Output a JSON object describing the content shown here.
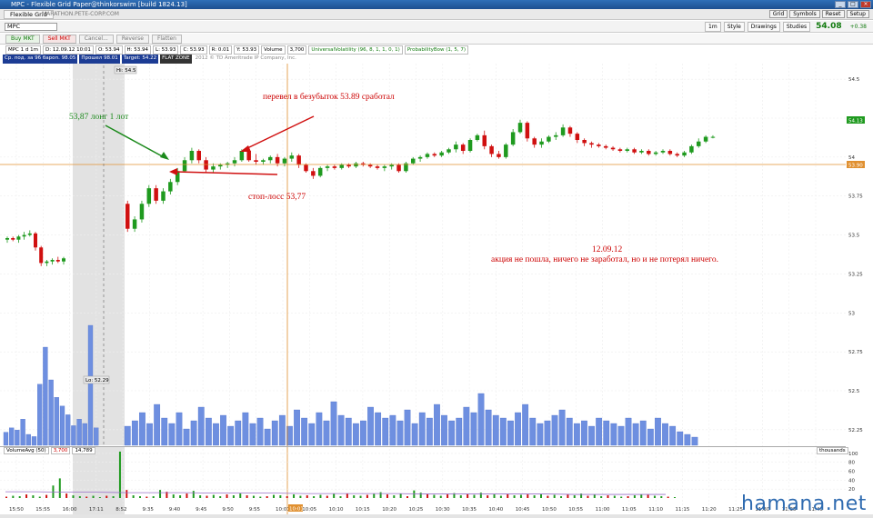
{
  "window": {
    "title": "MPC - Flexible Grid Paper@thinkorswim [build 1824.13]",
    "buttons": [
      "_",
      "□",
      "×"
    ]
  },
  "menubar": {
    "tab": "Flexible Grid",
    "site": "MARATHON.PETE-CORP.COM",
    "buttons": [
      "Grid",
      "Symbols",
      "Reset",
      "Setup"
    ]
  },
  "toolbar": {
    "symbol": "MPC",
    "aggregation": "1m",
    "controls": [
      "Style",
      "Drawings",
      "Studies"
    ],
    "last_price": "54.08",
    "change": "+0.38"
  },
  "order_bar": {
    "buy": "Buy MKT",
    "sell": "Sell MKT",
    "cancel": "Cancel...",
    "reverse": "Reverse",
    "flatten": "Flatten"
  },
  "info_bar": {
    "symbol": "MPC 1 d 1m",
    "date": "D: 12.09.12 10:01",
    "open": "O: 53.94",
    "high": "H: 53.94",
    "low": "L: 53.93",
    "close": "C: 53.93",
    "range": "R: 0.01",
    "y": "Y: 53.93",
    "volume_label": "Volume",
    "volume_val": "3,700",
    "study1": "UniversalVolatility (96, 8, 1, 1, 0, 1)",
    "study2": "ProbabilityBow (1, 5, 7)"
  },
  "position_bar": {
    "avg_price": "Ср. под. за 96 бароп. 98.05",
    "pnl": "Прошел 98.01",
    "target": "Target: 54.22",
    "flat": "FLAT ZONE",
    "copyright": "2012 © TD Ameritrade IP Company, Inc."
  },
  "volume_panel": {
    "label": "VolumeAvg (50)",
    "val1": "3,700",
    "val2": "14,789",
    "units": "thousands"
  },
  "annotations": {
    "long": "53,87 лонг 1 лот",
    "breakeven": "перевел в безубыток 53.89 сработал",
    "stop": "стоп-лосс 53,77",
    "date": "12.09.12",
    "summary": "акция не пошла, ничего не заработал, но и  не потерял ничего."
  },
  "markers": {
    "high": "Hi: 54.5",
    "low": "Lo: 52.29"
  },
  "watermark": "hamana.net",
  "colors": {
    "up": "#1f9a1f",
    "down": "#d01010",
    "volume_bar": "#6e8fe0",
    "arrow_green": "#1c8a1c",
    "arrow_red": "#d01010",
    "price_line": "#e09030"
  },
  "chart_data": {
    "type": "candlestick",
    "price_axis": [
      "54.5",
      "54.25",
      "54",
      "53.75",
      "53.5",
      "53.25",
      "53",
      "52.75",
      "52.5",
      "52.25"
    ],
    "ylim": [
      52.15,
      54.6
    ],
    "time_labels": [
      "15:50",
      "15:55",
      "16:00",
      "17:11",
      "8:52",
      "9:35",
      "9:40",
      "9:45",
      "9:50",
      "9:55",
      "10:01",
      "10:05",
      "10:10",
      "10:15",
      "10:20",
      "10:25",
      "10:30",
      "10:35",
      "10:40",
      "10:45",
      "10:50",
      "10:55",
      "11:00",
      "11:05",
      "11:10",
      "11:15",
      "11:20",
      "11:25",
      "11:30",
      "11:35",
      "11:40"
    ],
    "last_price_label": "54.13",
    "crosshair_price_label": "53.90",
    "crosshair_time_label": "10:01",
    "volume_axis": [
      "100",
      "80",
      "60",
      "40",
      "20"
    ],
    "volume_ylim": [
      0,
      110
    ],
    "candles_pre": [
      {
        "o": 53.47,
        "h": 53.49,
        "l": 53.45,
        "c": 53.48
      },
      {
        "o": 53.48,
        "h": 53.49,
        "l": 53.46,
        "c": 53.47
      },
      {
        "o": 53.47,
        "h": 53.5,
        "l": 53.45,
        "c": 53.49
      },
      {
        "o": 53.49,
        "h": 53.52,
        "l": 53.47,
        "c": 53.5
      },
      {
        "o": 53.5,
        "h": 53.53,
        "l": 53.49,
        "c": 53.51
      },
      {
        "o": 53.51,
        "h": 53.52,
        "l": 53.4,
        "c": 53.42
      },
      {
        "o": 53.42,
        "h": 53.43,
        "l": 53.3,
        "c": 53.32
      },
      {
        "o": 53.32,
        "h": 53.34,
        "l": 53.3,
        "c": 53.33
      },
      {
        "o": 53.33,
        "h": 53.35,
        "l": 53.31,
        "c": 53.34
      },
      {
        "o": 53.34,
        "h": 53.36,
        "l": 53.32,
        "c": 53.33
      },
      {
        "o": 53.33,
        "h": 53.36,
        "l": 53.31,
        "c": 53.35
      }
    ],
    "candles": [
      {
        "o": 53.7,
        "h": 53.72,
        "l": 53.52,
        "c": 53.54
      },
      {
        "o": 53.54,
        "h": 53.62,
        "l": 53.52,
        "c": 53.6
      },
      {
        "o": 53.6,
        "h": 53.72,
        "l": 53.58,
        "c": 53.7
      },
      {
        "o": 53.7,
        "h": 53.82,
        "l": 53.68,
        "c": 53.8
      },
      {
        "o": 53.8,
        "h": 53.82,
        "l": 53.7,
        "c": 53.72
      },
      {
        "o": 53.72,
        "h": 53.8,
        "l": 53.7,
        "c": 53.78
      },
      {
        "o": 53.78,
        "h": 53.86,
        "l": 53.76,
        "c": 53.84
      },
      {
        "o": 53.84,
        "h": 53.93,
        "l": 53.82,
        "c": 53.91
      },
      {
        "o": 53.91,
        "h": 54.0,
        "l": 53.9,
        "c": 53.98
      },
      {
        "o": 53.98,
        "h": 54.06,
        "l": 53.96,
        "c": 54.04
      },
      {
        "o": 54.04,
        "h": 54.05,
        "l": 53.96,
        "c": 53.98
      },
      {
        "o": 53.98,
        "h": 54.0,
        "l": 53.9,
        "c": 53.92
      },
      {
        "o": 53.92,
        "h": 53.96,
        "l": 53.9,
        "c": 53.94
      },
      {
        "o": 53.94,
        "h": 53.96,
        "l": 53.92,
        "c": 53.95
      },
      {
        "o": 53.95,
        "h": 53.97,
        "l": 53.93,
        "c": 53.96
      },
      {
        "o": 53.96,
        "h": 54.0,
        "l": 53.94,
        "c": 53.98
      },
      {
        "o": 53.98,
        "h": 54.05,
        "l": 53.97,
        "c": 54.04
      },
      {
        "o": 54.04,
        "h": 54.06,
        "l": 53.97,
        "c": 53.98
      },
      {
        "o": 53.98,
        "h": 54.02,
        "l": 53.95,
        "c": 53.97
      },
      {
        "o": 53.97,
        "h": 53.99,
        "l": 53.95,
        "c": 53.98
      },
      {
        "o": 53.98,
        "h": 54.01,
        "l": 53.96,
        "c": 54.0
      },
      {
        "o": 54.0,
        "h": 54.02,
        "l": 53.94,
        "c": 53.96
      },
      {
        "o": 53.96,
        "h": 54.0,
        "l": 53.94,
        "c": 53.99
      },
      {
        "o": 53.99,
        "h": 54.03,
        "l": 53.97,
        "c": 54.01
      },
      {
        "o": 54.01,
        "h": 54.02,
        "l": 53.93,
        "c": 53.95
      },
      {
        "o": 53.95,
        "h": 53.96,
        "l": 53.9,
        "c": 53.91
      },
      {
        "o": 53.91,
        "h": 53.93,
        "l": 53.86,
        "c": 53.88
      },
      {
        "o": 53.88,
        "h": 53.94,
        "l": 53.87,
        "c": 53.93
      },
      {
        "o": 53.93,
        "h": 53.95,
        "l": 53.91,
        "c": 53.94
      },
      {
        "o": 53.94,
        "h": 53.95,
        "l": 53.92,
        "c": 53.93
      },
      {
        "o": 53.93,
        "h": 53.96,
        "l": 53.92,
        "c": 53.95
      },
      {
        "o": 53.95,
        "h": 53.96,
        "l": 53.93,
        "c": 53.94
      },
      {
        "o": 53.94,
        "h": 53.97,
        "l": 53.93,
        "c": 53.96
      },
      {
        "o": 53.96,
        "h": 53.97,
        "l": 53.94,
        "c": 53.95
      },
      {
        "o": 53.95,
        "h": 53.96,
        "l": 53.93,
        "c": 53.94
      },
      {
        "o": 53.94,
        "h": 53.95,
        "l": 53.92,
        "c": 53.93
      },
      {
        "o": 53.93,
        "h": 53.95,
        "l": 53.91,
        "c": 53.94
      },
      {
        "o": 53.94,
        "h": 53.96,
        "l": 53.92,
        "c": 53.95
      },
      {
        "o": 53.95,
        "h": 53.96,
        "l": 53.9,
        "c": 53.91
      },
      {
        "o": 53.91,
        "h": 53.97,
        "l": 53.9,
        "c": 53.96
      },
      {
        "o": 53.96,
        "h": 54.0,
        "l": 53.95,
        "c": 53.99
      },
      {
        "o": 53.99,
        "h": 54.01,
        "l": 53.97,
        "c": 54.0
      },
      {
        "o": 54.0,
        "h": 54.03,
        "l": 53.99,
        "c": 54.02
      },
      {
        "o": 54.02,
        "h": 54.03,
        "l": 54.0,
        "c": 54.01
      },
      {
        "o": 54.01,
        "h": 54.04,
        "l": 54.0,
        "c": 54.03
      },
      {
        "o": 54.03,
        "h": 54.06,
        "l": 54.02,
        "c": 54.05
      },
      {
        "o": 54.05,
        "h": 54.1,
        "l": 54.03,
        "c": 54.08
      },
      {
        "o": 54.08,
        "h": 54.09,
        "l": 54.02,
        "c": 54.04
      },
      {
        "o": 54.04,
        "h": 54.12,
        "l": 54.03,
        "c": 54.11
      },
      {
        "o": 54.11,
        "h": 54.15,
        "l": 54.1,
        "c": 54.14
      },
      {
        "o": 54.14,
        "h": 54.17,
        "l": 54.05,
        "c": 54.07
      },
      {
        "o": 54.07,
        "h": 54.08,
        "l": 54.0,
        "c": 54.02
      },
      {
        "o": 54.02,
        "h": 54.04,
        "l": 53.99,
        "c": 54.0
      },
      {
        "o": 54.0,
        "h": 54.09,
        "l": 53.99,
        "c": 54.08
      },
      {
        "o": 54.08,
        "h": 54.18,
        "l": 54.07,
        "c": 54.16
      },
      {
        "o": 54.16,
        "h": 54.24,
        "l": 54.15,
        "c": 54.22
      },
      {
        "o": 54.22,
        "h": 54.23,
        "l": 54.1,
        "c": 54.12
      },
      {
        "o": 54.12,
        "h": 54.13,
        "l": 54.06,
        "c": 54.08
      },
      {
        "o": 54.08,
        "h": 54.12,
        "l": 54.06,
        "c": 54.1
      },
      {
        "o": 54.1,
        "h": 54.14,
        "l": 54.09,
        "c": 54.13
      },
      {
        "o": 54.13,
        "h": 54.16,
        "l": 54.11,
        "c": 54.14
      },
      {
        "o": 54.14,
        "h": 54.21,
        "l": 54.13,
        "c": 54.19
      },
      {
        "o": 54.19,
        "h": 54.2,
        "l": 54.13,
        "c": 54.15
      },
      {
        "o": 54.15,
        "h": 54.16,
        "l": 54.09,
        "c": 54.11
      },
      {
        "o": 54.11,
        "h": 54.12,
        "l": 54.07,
        "c": 54.09
      },
      {
        "o": 54.09,
        "h": 54.1,
        "l": 54.06,
        "c": 54.08
      },
      {
        "o": 54.08,
        "h": 54.09,
        "l": 54.06,
        "c": 54.07
      },
      {
        "o": 54.07,
        "h": 54.08,
        "l": 54.05,
        "c": 54.06
      },
      {
        "o": 54.06,
        "h": 54.07,
        "l": 54.04,
        "c": 54.05
      },
      {
        "o": 54.05,
        "h": 54.06,
        "l": 54.03,
        "c": 54.04
      },
      {
        "o": 54.04,
        "h": 54.06,
        "l": 54.03,
        "c": 54.05
      },
      {
        "o": 54.05,
        "h": 54.06,
        "l": 54.02,
        "c": 54.03
      },
      {
        "o": 54.03,
        "h": 54.05,
        "l": 54.02,
        "c": 54.04
      },
      {
        "o": 54.04,
        "h": 54.05,
        "l": 54.01,
        "c": 54.02
      },
      {
        "o": 54.02,
        "h": 54.04,
        "l": 54.01,
        "c": 54.03
      },
      {
        "o": 54.03,
        "h": 54.05,
        "l": 54.02,
        "c": 54.04
      },
      {
        "o": 54.04,
        "h": 54.05,
        "l": 54.01,
        "c": 54.02
      },
      {
        "o": 54.02,
        "h": 54.03,
        "l": 54.0,
        "c": 54.01
      },
      {
        "o": 54.01,
        "h": 54.04,
        "l": 54.0,
        "c": 54.03
      },
      {
        "o": 54.03,
        "h": 54.08,
        "l": 54.02,
        "c": 54.07
      },
      {
        "o": 54.07,
        "h": 54.12,
        "l": 54.06,
        "c": 54.1
      },
      {
        "o": 54.1,
        "h": 54.14,
        "l": 54.09,
        "c": 54.13
      },
      {
        "o": 54.13,
        "h": 54.14,
        "l": 54.12,
        "c": 54.13
      }
    ],
    "volume_pre": [
      6,
      8,
      7,
      12,
      5,
      4,
      28,
      45,
      30,
      22,
      18,
      14,
      9,
      12,
      10,
      55,
      8
    ],
    "volume": [
      7,
      9,
      12,
      8,
      15,
      10,
      8,
      12,
      6,
      9,
      14,
      10,
      8,
      11,
      7,
      9,
      12,
      8,
      10,
      6,
      9,
      11,
      7,
      13,
      10,
      8,
      12,
      9,
      16,
      11,
      10,
      8,
      9,
      14,
      12,
      10,
      11,
      9,
      13,
      8,
      12,
      10,
      15,
      11,
      9,
      10,
      14,
      12,
      19,
      13,
      11,
      10,
      9,
      12,
      15,
      10,
      8,
      9,
      11,
      13,
      10,
      8,
      9,
      7,
      10,
      9,
      8,
      7,
      10,
      8,
      9,
      6,
      10,
      8,
      7,
      5,
      4,
      3
    ],
    "volume_lower": [
      3,
      5,
      4,
      8,
      6,
      3,
      7,
      28,
      44,
      10,
      6,
      4,
      3,
      5,
      2,
      5,
      4,
      104,
      18,
      6,
      4,
      3,
      4,
      18,
      14,
      8,
      6,
      10,
      16,
      6,
      5,
      7,
      4,
      8,
      6,
      10,
      6,
      5,
      3,
      4,
      7,
      6,
      4,
      8,
      5,
      6,
      4,
      7,
      5,
      9,
      4,
      10,
      6,
      5,
      7,
      9,
      13,
      8,
      6,
      10,
      4,
      17,
      12,
      9,
      7,
      5,
      8,
      11,
      6,
      9,
      7,
      12,
      6,
      8,
      5,
      9,
      6,
      7,
      8,
      6,
      9,
      5,
      7,
      4,
      8,
      6,
      10,
      5,
      7,
      4,
      6,
      5,
      3,
      4,
      6,
      8,
      7,
      5,
      4,
      3,
      2
    ],
    "volume_avg_line": [
      14,
      14,
      13,
      13,
      12,
      12,
      12,
      11,
      11,
      11,
      10,
      10,
      10,
      10,
      9,
      9,
      9,
      9,
      9,
      8,
      8,
      8,
      8
    ]
  }
}
